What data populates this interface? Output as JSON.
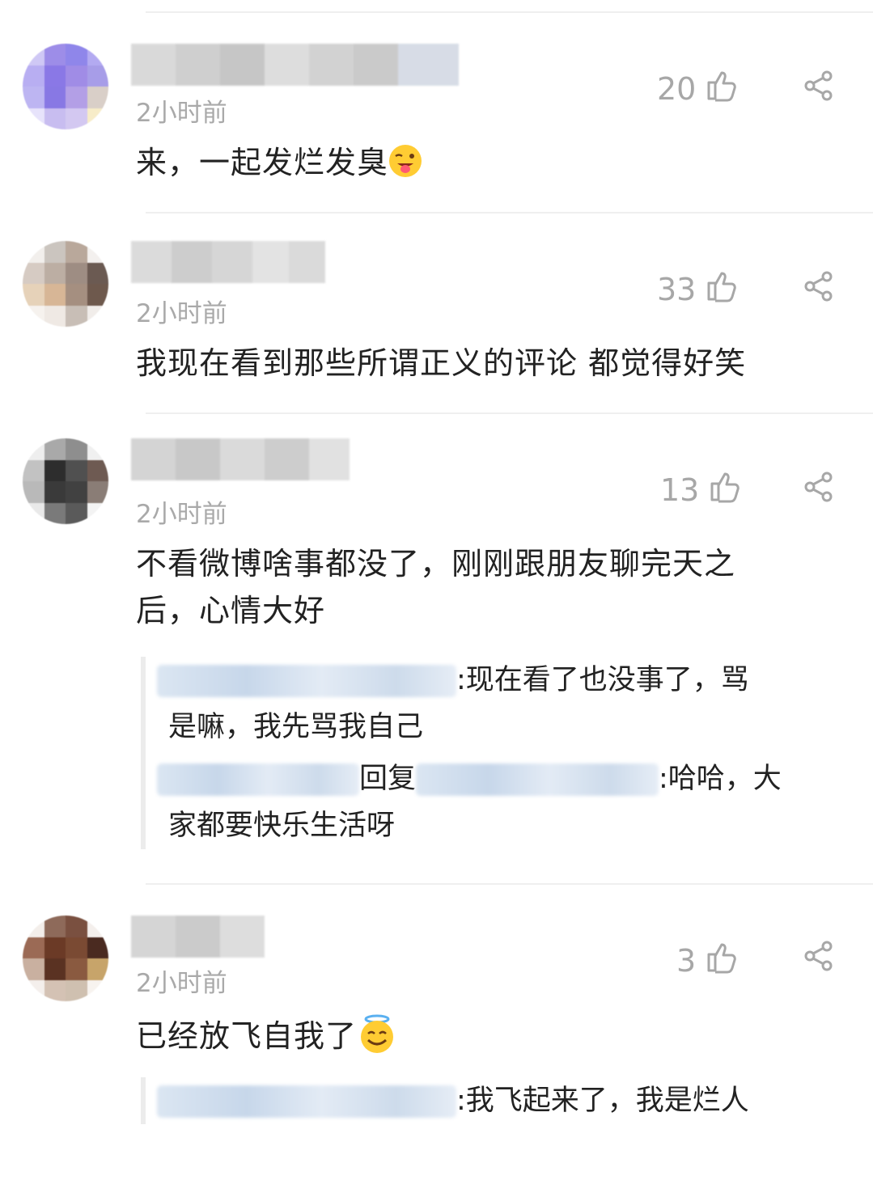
{
  "colors": {
    "time": "#a9a9a9",
    "like_count": "#a7a7a7",
    "text": "#222222",
    "divider": "#efefef",
    "reply_border": "#ececec",
    "blurred_name": "#cddbeb"
  },
  "icons": [
    "thumbs-up-icon",
    "share-icon",
    "winking-tongue-emoji",
    "halo-smile-emoji"
  ],
  "comments": [
    {
      "time": "2小时前",
      "likes": "20",
      "text": "来，一起发烂发臭",
      "emoji": "winking-tongue-emoji"
    },
    {
      "time": "2小时前",
      "likes": "33",
      "text": "我现在看到那些所谓正义的评论 都觉得好笑"
    },
    {
      "time": "2小时前",
      "likes": "13",
      "text_line1": "不看微博啥事都没了，刚刚跟朋友聊完天之",
      "text_line2": "后，心情大好",
      "replies": [
        {
          "text_line1": ":现在看了也没事了，骂",
          "text_line2": "是嘛，我先骂我自己"
        },
        {
          "reply_word": "回复",
          "text_line1": ":哈哈，大",
          "text_line2": "家都要快乐生活呀"
        }
      ]
    },
    {
      "time": "2小时前",
      "likes": "3",
      "text": "已经放飞自我了",
      "emoji": "halo-smile-emoji",
      "replies": [
        {
          "text_line1": ":我飞起来了，我是烂人"
        }
      ]
    }
  ]
}
